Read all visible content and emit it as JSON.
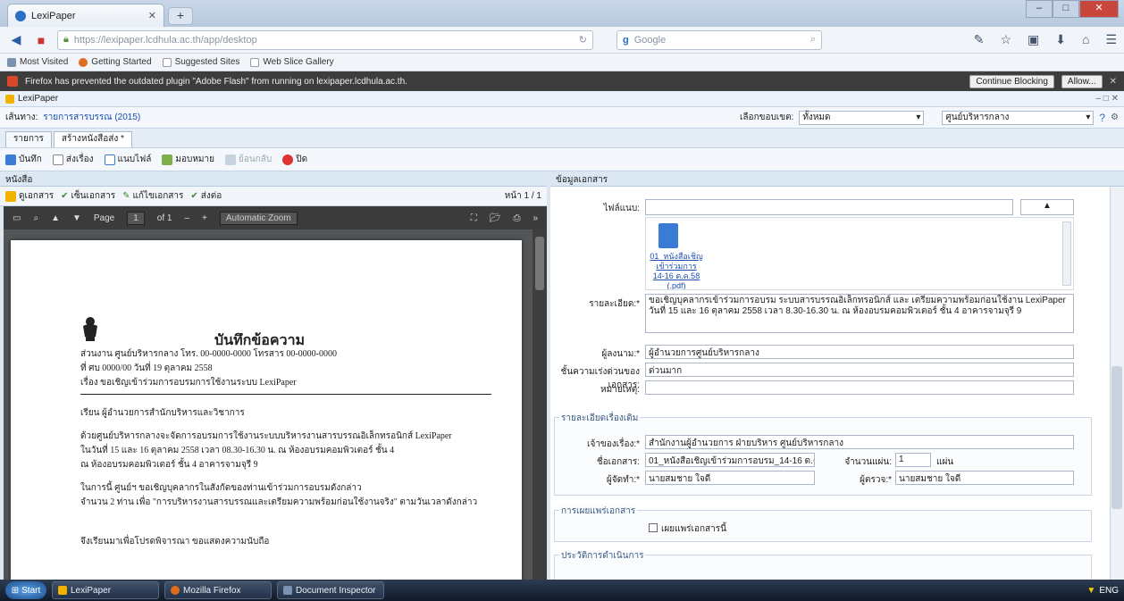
{
  "browser": {
    "tab_title": "LexiPaper",
    "new_tab": "+",
    "url": "https://lexipaper.lcdhula.ac.th/app/desktop",
    "search_placeholder": "Google",
    "bookmarks": [
      "Most Visited",
      "Getting Started",
      "Suggested Sites",
      "Web Slice Gallery"
    ],
    "notification": "Firefox has prevented the outdated plugin \"Adobe Flash\" from running on lexipaper.lcdhula.ac.th.",
    "notify_btn_continue": "Continue Blocking",
    "notify_btn_allow": "Allow..."
  },
  "app": {
    "title": "LexiPaper",
    "path_label": "เส้นทาง:",
    "path_value": "รายการสารบรรณ (2015)",
    "filter_label": "เลือกขอบเขต:",
    "filter_value": "ทั้งหมด",
    "unit_value": "ศูนย์บริหารกลาง",
    "doc_tabs": [
      "รายการ",
      "สร้างหนังสือส่ง *"
    ],
    "toolbar": {
      "save": "บันทึก",
      "send": "ส่งเรื่อง",
      "attach": "แนบไฟล์",
      "assign": "มอบหมาย",
      "revert": "ย้อนกลับ",
      "close": "ปิด"
    }
  },
  "left": {
    "header": "หนังสือ",
    "tools": [
      "ดูเอกสาร",
      "เซ็นเอกสาร",
      "แก้ไขเอกสาร",
      "ส่งต่อ"
    ],
    "page_nav": "หน้า 1 / 1",
    "pdf": {
      "page_label": "Page",
      "page_num": "1",
      "page_of": "of 1",
      "zoom": "Automatic Zoom"
    },
    "memo": {
      "title": "บันทึกข้อความ",
      "line1": "ส่วนงาน  ศูนย์บริหารกลาง                โทร.  00-0000-0000          โทรสาร  00-0000-0000",
      "line2": "ที่  ศบ 0000/00              วันที่  19 ตุลาคม 2558",
      "line3": "เรื่อง  ขอเชิญเข้าร่วมการอบรมการใช้งานระบบ LexiPaper",
      "line4": "เรียน  ผู้อำนวยการสำนักบริหารและวิชาการ",
      "line5": "          ด้วยศูนย์บริหารกลางจะจัดการอบรมการใช้งานระบบบริหารงานสารบรรณอิเล็กทรอนิกส์ LexiPaper",
      "line6": "ในวันที่ 15 และ 16 ตุลาคม 2558 เวลา 08.30-16.30 น. ณ ห้องอบรมคอมพิวเตอร์ ชั้น 4",
      "line7": "ณ ห้องอบรมคอมพิวเตอร์ ชั้น 4 อาคารจามจุรี 9",
      "line8": "          ในการนี้ ศูนย์ฯ ขอเชิญบุคลากรในสังกัดของท่านเข้าร่วมการอบรมดังกล่าว",
      "line9": "จำนวน 2 ท่าน เพื่อ \"การบริหารงานสารบรรณและเตรียมความพร้อมก่อนใช้งานจริง\" ตามวันเวลาดังกล่าว",
      "line10": "จึงเรียนมาเพื่อโปรดพิจารณา ขอแสดงความนับถือ"
    }
  },
  "right": {
    "header": "ข้อมูลเอกสาร",
    "attach_label": "ไฟล์แนบ:",
    "attach_file": "01_หนังสือเชิญเข้าร่วมการอบรม_14-16 ต.ค.58",
    "attach_file_short1": "01_หนังสือเชิญ",
    "attach_file_short2": "เข้าร่วมการ",
    "attach_file_short3": "14-16 ต.ค.58",
    "attach_file_ext": "(.pdf)",
    "subject_label": "รายละเอียด:*",
    "subject_text": "ขอเชิญบุคลากรเข้าร่วมการอบรม ระบบสารบรรณอิเล็กทรอนิกส์ และ เตรียมความพร้อมก่อนใช้งาน LexiPaper วันที่ 15 และ 16 ตุลาคม 2558 เวลา 8.30-16.30 น. ณ ห้องอบรมคอมพิวเตอร์ ชั้น 4 อาคารจามจุรี 9",
    "to_label": "ผู้ลงนาม:*",
    "to_value": "ผู้อำนวยการศูนย์บริหารกลาง",
    "urgency_label": "ชั้นความเร่งด่วนของเอกสาร:",
    "urgency_value": "ด่วนมาก",
    "note_label": "หมายเหตุ:",
    "group1_title": "รายละเอียดเรื่องเดิม",
    "owner_label": "เจ้าของเรื่อง:*",
    "owner_value": "สำนักงานผู้อำนวยการ ฝ่ายบริหาร ศูนย์บริหารกลาง",
    "docname_label": "ชื่อเอกสาร:",
    "docname_value": "01_หนังสือเชิญเข้าร่วมการอบรม_14-16 ต.ค.58",
    "count_label": "จำนวนแผ่น:",
    "count_value": "1",
    "count_unit": "แผ่น",
    "creator_label": "ผู้จัดทำ:*",
    "creator_value": "นายสมชาย ใจดี",
    "approver_label": "ผู้ตรวจ:*",
    "approver_value": "นายสมชาย ใจดี",
    "group2_title": "การเผยแพร่เอกสาร",
    "checkbox_label": "เผยแพร่เอกสารนี้",
    "group3_title": "ประวัติการดำเนินการ"
  },
  "taskbar": {
    "start": "Start",
    "tasks": [
      "LexiPaper",
      "Mozilla Firefox",
      "Document Inspector"
    ],
    "tray": "ENG"
  },
  "colors": {
    "accent": "#1a4dad",
    "close_red": "#c9463d",
    "pdf_bg": "#525659"
  }
}
